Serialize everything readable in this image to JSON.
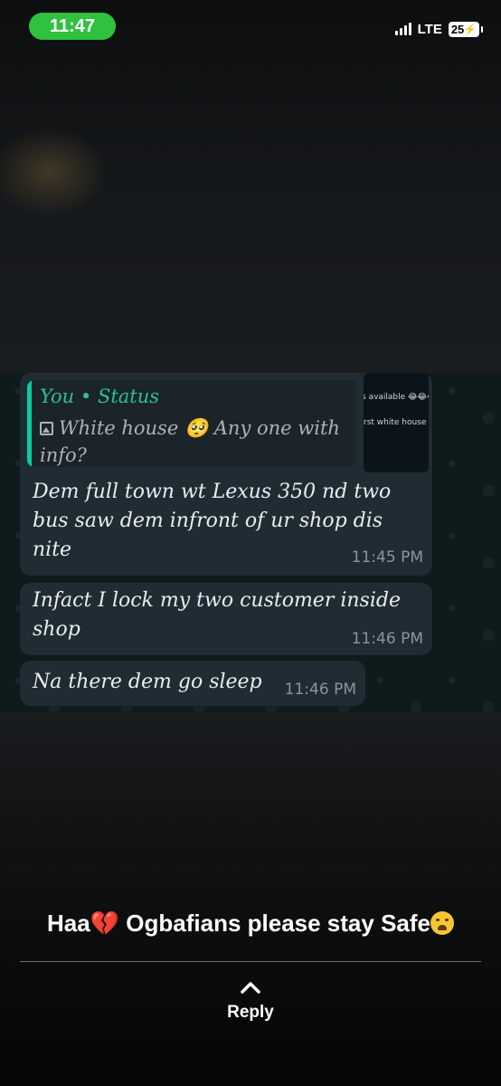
{
  "status_bar": {
    "time": "11:47",
    "network": "LTE",
    "battery": "25",
    "battery_icon": "battery-charging-icon",
    "time_pill_color": "#30c13f"
  },
  "chat": {
    "reply_quote": {
      "title": "You • Status",
      "body": "White house 🥺 Any one with info?",
      "thumbnail_lines": [
        "s available 😂😂😂",
        "rst white house fi"
      ]
    },
    "messages": [
      {
        "text": "Dem full town wt Lexus 350 nd two bus saw dem infront of ur shop dis nite",
        "time": "11:45 PM"
      },
      {
        "text": "Infact I lock my two customer inside shop",
        "time": "11:46 PM"
      },
      {
        "text": "Na there dem go sleep",
        "time": "11:46 PM"
      }
    ],
    "quote_accent_color": "#06cf9c",
    "bubble_color": "#202c33"
  },
  "caption": {
    "before_heart": "Haa",
    "heart": "💔",
    "after_heart": " Ogbafians please stay Safe",
    "end_emoji": "weary-face-emoji"
  },
  "reply": {
    "label": "Reply",
    "icon": "chevron-up-icon"
  }
}
